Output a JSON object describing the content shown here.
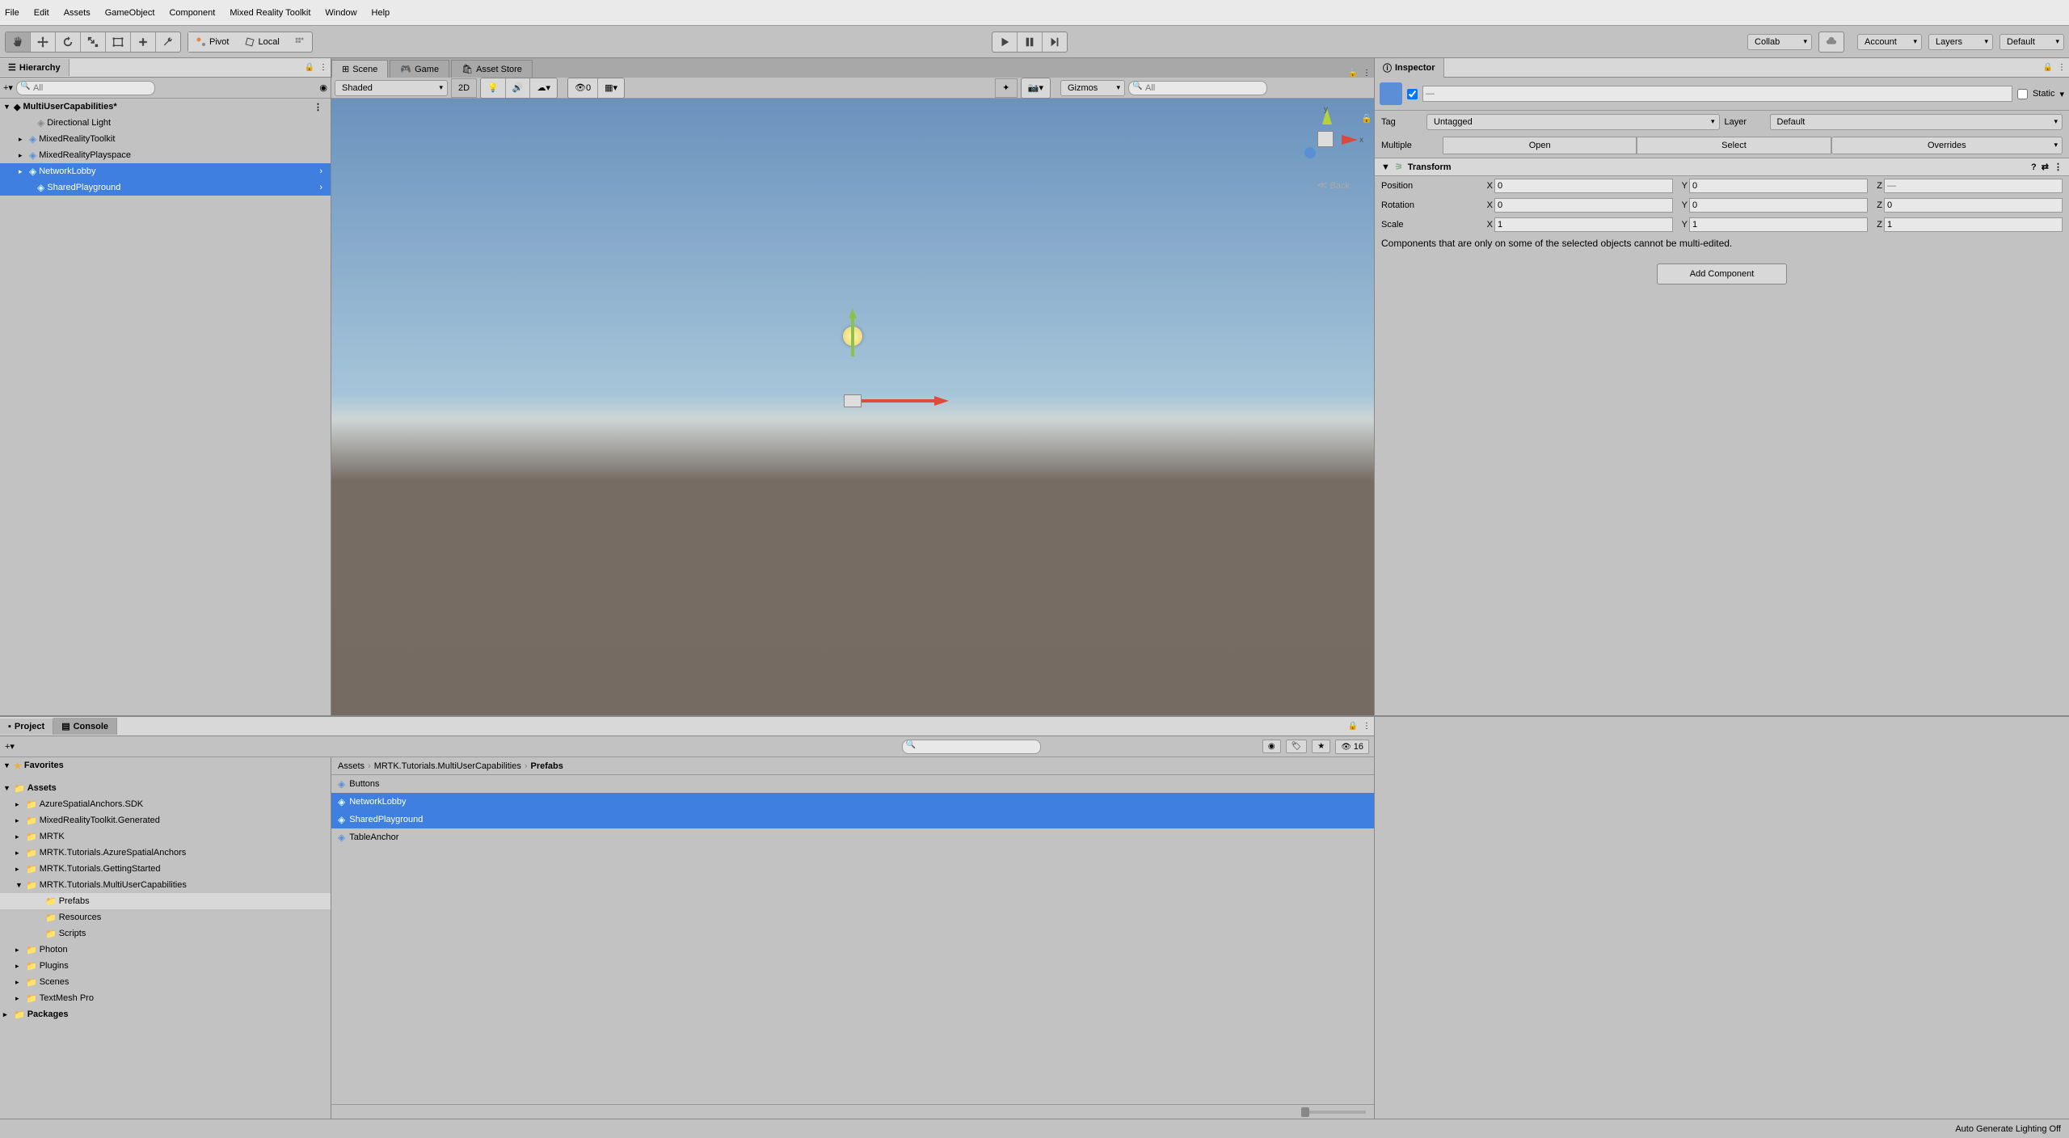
{
  "menubar": [
    "File",
    "Edit",
    "Assets",
    "GameObject",
    "Component",
    "Mixed Reality Toolkit",
    "Window",
    "Help"
  ],
  "toolbar": {
    "pivot": "Pivot",
    "local": "Local",
    "collab": "Collab",
    "account": "Account",
    "layers": "Layers",
    "layout": "Default"
  },
  "hierarchy": {
    "title": "Hierarchy",
    "search_placeholder": "All",
    "scene": "MultiUserCapabilities*",
    "items": [
      {
        "label": "Directional Light",
        "indent": 1,
        "icon": "cube"
      },
      {
        "label": "MixedRealityToolkit",
        "indent": 1,
        "icon": "prefab",
        "expand": true
      },
      {
        "label": "MixedRealityPlayspace",
        "indent": 1,
        "icon": "prefab",
        "expand": true
      },
      {
        "label": "NetworkLobby",
        "indent": 1,
        "icon": "prefab",
        "expand": true,
        "selected": true,
        "arrow": true
      },
      {
        "label": "SharedPlayground",
        "indent": 1,
        "icon": "prefab",
        "selected": true,
        "arrow": true
      }
    ]
  },
  "scene": {
    "tab_scene": "Scene",
    "tab_game": "Game",
    "tab_asset_store": "Asset Store",
    "shaded": "Shaded",
    "two_d": "2D",
    "gizmos": "Gizmos",
    "search_placeholder": "All",
    "back": "Back",
    "hidden_count": "0"
  },
  "inspector": {
    "title": "Inspector",
    "static": "Static",
    "tag_label": "Tag",
    "tag_value": "Untagged",
    "layer_label": "Layer",
    "layer_value": "Default",
    "multiple": "Multiple",
    "open": "Open",
    "select": "Select",
    "overrides": "Overrides",
    "transform": "Transform",
    "position": "Position",
    "rotation": "Rotation",
    "scale": "Scale",
    "pos": {
      "x": "0",
      "y": "0",
      "z": ""
    },
    "rot": {
      "x": "0",
      "y": "0",
      "z": "0"
    },
    "scl": {
      "x": "1",
      "y": "1",
      "z": "1"
    },
    "notice": "Components that are only on some of the selected objects cannot be multi-edited.",
    "add_component": "Add Component",
    "name_placeholder": "—"
  },
  "project": {
    "tab_project": "Project",
    "tab_console": "Console",
    "count": "16",
    "favorites": "Favorites",
    "assets": "Assets",
    "packages": "Packages",
    "tree": [
      {
        "label": "AzureSpatialAnchors.SDK",
        "indent": 1
      },
      {
        "label": "MixedRealityToolkit.Generated",
        "indent": 1
      },
      {
        "label": "MRTK",
        "indent": 1
      },
      {
        "label": "MRTK.Tutorials.AzureSpatialAnchors",
        "indent": 1
      },
      {
        "label": "MRTK.Tutorials.GettingStarted",
        "indent": 1
      },
      {
        "label": "MRTK.Tutorials.MultiUserCapabilities",
        "indent": 1,
        "expanded": true
      },
      {
        "label": "Prefabs",
        "indent": 2,
        "selected": true
      },
      {
        "label": "Resources",
        "indent": 2
      },
      {
        "label": "Scripts",
        "indent": 2
      },
      {
        "label": "Photon",
        "indent": 1
      },
      {
        "label": "Plugins",
        "indent": 1
      },
      {
        "label": "Scenes",
        "indent": 1
      },
      {
        "label": "TextMesh Pro",
        "indent": 1
      }
    ],
    "breadcrumb": [
      "Assets",
      "MRTK.Tutorials.MultiUserCapabilities",
      "Prefabs"
    ],
    "items": [
      {
        "label": "Buttons"
      },
      {
        "label": "NetworkLobby",
        "selected": true
      },
      {
        "label": "SharedPlayground",
        "selected": true
      },
      {
        "label": "TableAnchor"
      }
    ]
  },
  "statusbar": "Auto Generate Lighting Off"
}
